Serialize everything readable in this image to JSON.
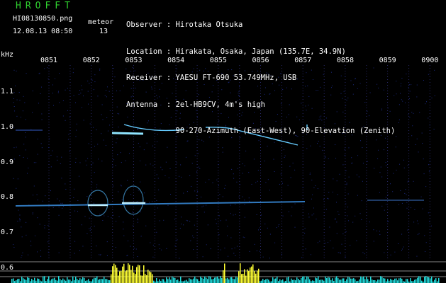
{
  "header": {
    "logo": "HROFFT",
    "filename": "HI08130850.png",
    "datetime": "12.08.13 08:50",
    "meteor_label": "meteor",
    "meteor_count": "13"
  },
  "station": {
    "observer_key": "Observer",
    "observer_val": "Hirotaka Otsuka",
    "location_key": "Location",
    "location_val": "Hirakata, Osaka, Japan (135.7E, 34.9N)",
    "receiver_key": "Receiver",
    "receiver_val": "YAESU FT-690 53.749MHz, USB",
    "antenna_key": "Antenna",
    "antenna_val": "2el-HB9CV, 4m's high",
    "antenna_val2": "90-270-Azimuth (East-West), 90-Elevation (Zenith)"
  },
  "axes": {
    "y_unit": "kHz",
    "time_labels": [
      "0851",
      "0852",
      "0853",
      "0854",
      "0855",
      "0856",
      "0857",
      "0858",
      "0859",
      "0900"
    ],
    "freq_labels": [
      "1.1",
      "1.0",
      "0.9",
      "0.8",
      "0.7",
      "0.6"
    ]
  },
  "colors": {
    "background": "#000000",
    "logo": "#2fd12f",
    "grid": "#2a2a6a",
    "signal": "#66ccff",
    "level_cyan": "#22dddd",
    "level_yellow": "#ffff33"
  }
}
